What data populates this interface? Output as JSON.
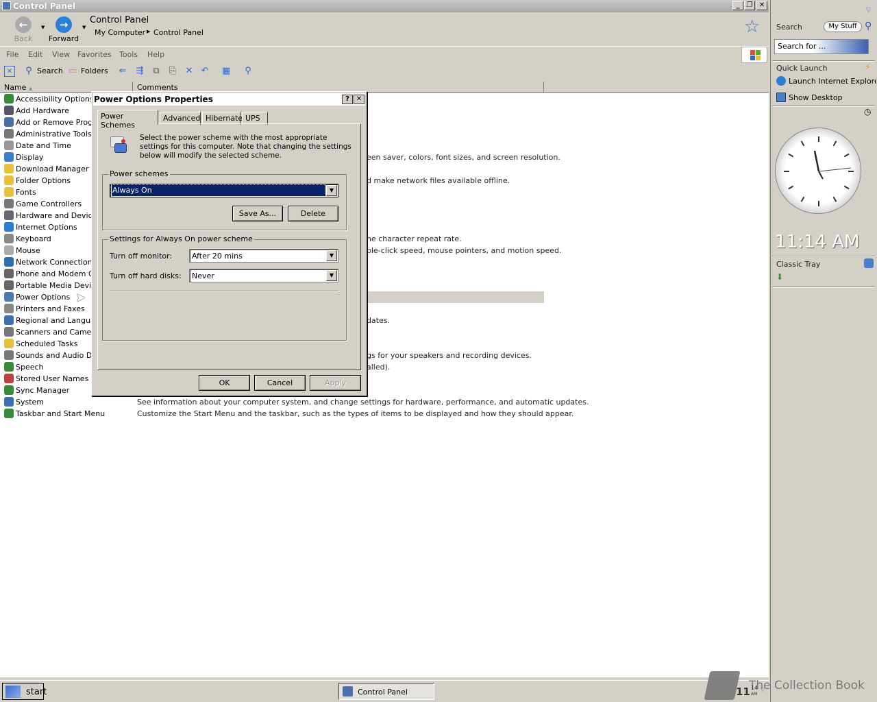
{
  "window": {
    "title": "Control Panel"
  },
  "nav": {
    "back": "Back",
    "forward": "Forward",
    "title": "Control Panel",
    "crumb1": "My Computer",
    "crumb2": "Control Panel"
  },
  "menu": {
    "file": "File",
    "edit": "Edit",
    "view": "View",
    "favorites": "Favorites",
    "tools": "Tools",
    "help": "Help"
  },
  "toolbar": {
    "search": "Search",
    "folders": "Folders"
  },
  "columns": {
    "name": "Name",
    "comments": "Comments"
  },
  "items": [
    {
      "label": "Accessibility Options",
      "color": "#3a8a3a"
    },
    {
      "label": "Add Hardware",
      "color": "#556"
    },
    {
      "label": "Add or Remove Progra",
      "color": "#4a6fa5"
    },
    {
      "label": "Administrative Tools",
      "color": "#777"
    },
    {
      "label": "Date and Time",
      "color": "#999"
    },
    {
      "label": "Display",
      "color": "#3a7fc8"
    },
    {
      "label": "Download Manager",
      "color": "#e8c040"
    },
    {
      "label": "Folder Options",
      "color": "#e8c040"
    },
    {
      "label": "Fonts",
      "color": "#e8c040"
    },
    {
      "label": "Game Controllers",
      "color": "#777"
    },
    {
      "label": "Hardware and Devices",
      "color": "#667"
    },
    {
      "label": "Internet Options",
      "color": "#2a7fd0"
    },
    {
      "label": "Keyboard",
      "color": "#888"
    },
    {
      "label": "Mouse",
      "color": "#aaa"
    },
    {
      "label": "Network Connections",
      "color": "#2a70b0"
    },
    {
      "label": "Phone and Modem Opt",
      "color": "#666"
    },
    {
      "label": "Portable Media Devices",
      "color": "#666"
    },
    {
      "label": "Power Options",
      "color": "#4a7ab0"
    },
    {
      "label": "Printers and Faxes",
      "color": "#888"
    },
    {
      "label": "Regional and Language",
      "color": "#3a70b0"
    },
    {
      "label": "Scanners and Cameras",
      "color": "#777"
    },
    {
      "label": "Scheduled Tasks",
      "color": "#e8c040"
    },
    {
      "label": "Sounds and Audio Dev",
      "color": "#777"
    },
    {
      "label": "Speech",
      "color": "#3a8a3a"
    },
    {
      "label": "Stored User Names an",
      "color": "#c04040"
    },
    {
      "label": "Sync Manager",
      "color": "#3a8a3a"
    },
    {
      "label": "System",
      "color": "#3a70b0"
    },
    {
      "label": "Taskbar and Start Menu",
      "color": "#3a8a3a"
    }
  ],
  "comments": [
    "een saver, colors, font sizes, and screen resolution.",
    "d make network files available offline.",
    "he character repeat rate.",
    "ble-click speed, mouse pointers, and motion speed.",
    "dates.",
    "gs for your speakers and recording devices.",
    "alled).",
    "See information about your computer system, and change settings for hardware, performance, and automatic updates.",
    "Customize the Start Menu and the taskbar, such as the types of items to be displayed and how they should appear."
  ],
  "dialog": {
    "title": "Power Options Properties",
    "tabs": [
      "Power Schemes",
      "Advanced",
      "Hibernate",
      "UPS"
    ],
    "description": "Select the power scheme with the most appropriate settings for this computer. Note that changing the settings below will modify the selected scheme.",
    "schemes_group": "Power schemes",
    "scheme_value": "Always On",
    "save_as": "Save As...",
    "delete": "Delete",
    "settings_group": "Settings for Always On power scheme",
    "monitor_label": "Turn off monitor:",
    "monitor_value": "After 20 mins",
    "disks_label": "Turn off hard disks:",
    "disks_value": "Never",
    "ok": "OK",
    "cancel": "Cancel",
    "apply": "Apply"
  },
  "sidebar": {
    "search_label": "Search",
    "mystuff": "My Stuff",
    "search_placeholder": "Search for ...",
    "quick_launch": "Quick Launch",
    "ql_items": [
      "Launch Internet Explore",
      "Show Desktop"
    ],
    "time": "11:14 AM",
    "classic_tray": "Classic Tray"
  },
  "taskbar": {
    "start": "start",
    "task": "Control Panel",
    "clock_hour": "11",
    "clock_min": "14",
    "clock_ampm": "AM",
    "watermark": "The Collection Book"
  }
}
